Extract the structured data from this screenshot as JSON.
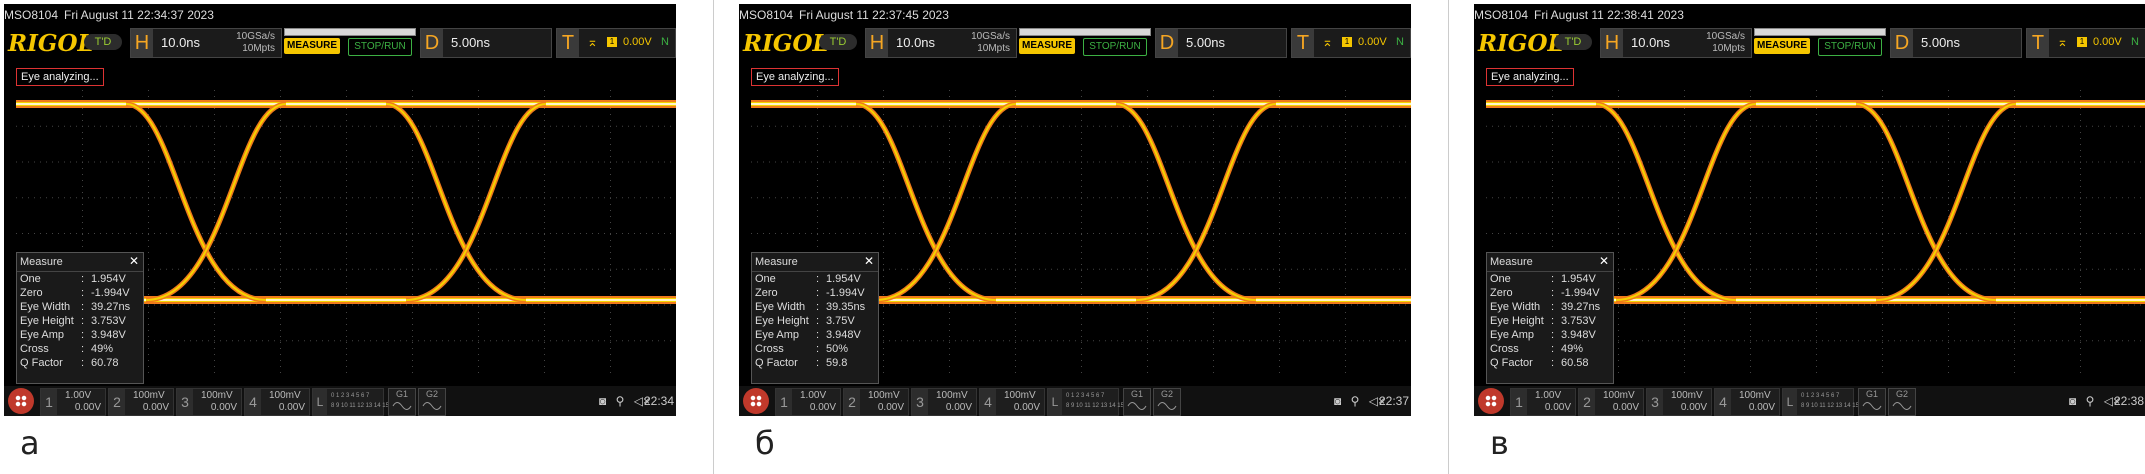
{
  "panels": [
    {
      "caption": "а",
      "model": "MSO8104",
      "datetime": "Fri August 11 22:34:37 2023",
      "logo": "RIGOL",
      "td": "T'D",
      "h_letter": "H",
      "timebase": "10.0ns",
      "samplerate": "10GSa/s",
      "memdepth": "10Mpts",
      "measure_btn": "MEASURE",
      "stop_btn": "STOP/RUN",
      "d_letter": "D",
      "delay": "5.00ns",
      "t_letter": "T",
      "trig_level": "0.00V",
      "trig_mode": "N",
      "trig_src": "1",
      "status": "Eye analyzing...",
      "measure": {
        "title": "Measure",
        "close": "✕",
        "rows": [
          {
            "k": "One",
            "v": "1.954V"
          },
          {
            "k": "Zero",
            "v": "-1.994V"
          },
          {
            "k": "Eye Width",
            "v": "39.27ns"
          },
          {
            "k": "Eye Height",
            "v": "3.753V"
          },
          {
            "k": "Eye Amp",
            "v": "3.948V"
          },
          {
            "k": "Cross",
            "v": "49%"
          },
          {
            "k": "Q Factor",
            "v": "60.78"
          }
        ]
      },
      "channels": [
        {
          "n": "1",
          "scale": "1.00V",
          "off": "0.00V"
        },
        {
          "n": "2",
          "scale": "100mV",
          "off": "0.00V"
        },
        {
          "n": "3",
          "scale": "100mV",
          "off": "0.00V"
        },
        {
          "n": "4",
          "scale": "100mV",
          "off": "0.00V"
        }
      ],
      "logic": {
        "n": "L",
        "r1": "0 1 2 3  4 5 6 7",
        "r2": "8 9 10 11 12 13 14 15"
      },
      "g1": "G1",
      "g2": "G2",
      "time": "22:34"
    },
    {
      "caption": "б",
      "model": "MSO8104",
      "datetime": "Fri August 11 22:37:45 2023",
      "logo": "RIGOL",
      "td": "T'D",
      "h_letter": "H",
      "timebase": "10.0ns",
      "samplerate": "10GSa/s",
      "memdepth": "10Mpts",
      "measure_btn": "MEASURE",
      "stop_btn": "STOP/RUN",
      "d_letter": "D",
      "delay": "5.00ns",
      "t_letter": "T",
      "trig_level": "0.00V",
      "trig_mode": "N",
      "trig_src": "1",
      "status": "Eye analyzing...",
      "measure": {
        "title": "Measure",
        "close": "✕",
        "rows": [
          {
            "k": "One",
            "v": "1.954V"
          },
          {
            "k": "Zero",
            "v": "-1.994V"
          },
          {
            "k": "Eye Width",
            "v": "39.35ns"
          },
          {
            "k": "Eye Height",
            "v": "3.75V"
          },
          {
            "k": "Eye Amp",
            "v": "3.948V"
          },
          {
            "k": "Cross",
            "v": "50%"
          },
          {
            "k": "Q Factor",
            "v": "59.8"
          }
        ]
      },
      "channels": [
        {
          "n": "1",
          "scale": "1.00V",
          "off": "0.00V"
        },
        {
          "n": "2",
          "scale": "100mV",
          "off": "0.00V"
        },
        {
          "n": "3",
          "scale": "100mV",
          "off": "0.00V"
        },
        {
          "n": "4",
          "scale": "100mV",
          "off": "0.00V"
        }
      ],
      "logic": {
        "n": "L",
        "r1": "0 1 2 3  4 5 6 7",
        "r2": "8 9 10 11 12 13 14 15"
      },
      "g1": "G1",
      "g2": "G2",
      "time": "22:37"
    },
    {
      "caption": "в",
      "model": "MSO8104",
      "datetime": "Fri August 11 22:38:41 2023",
      "logo": "RIGOL",
      "td": "T'D",
      "h_letter": "H",
      "timebase": "10.0ns",
      "samplerate": "10GSa/s",
      "memdepth": "10Mpts",
      "measure_btn": "MEASURE",
      "stop_btn": "STOP/RUN",
      "d_letter": "D",
      "delay": "5.00ns",
      "t_letter": "T",
      "trig_level": "0.00V",
      "trig_mode": "N",
      "trig_src": "1",
      "status": "Eye analyzing...",
      "measure": {
        "title": "Measure",
        "close": "✕",
        "rows": [
          {
            "k": "One",
            "v": "1.954V"
          },
          {
            "k": "Zero",
            "v": "-1.994V"
          },
          {
            "k": "Eye Width",
            "v": "39.27ns"
          },
          {
            "k": "Eye Height",
            "v": "3.753V"
          },
          {
            "k": "Eye Amp",
            "v": "3.948V"
          },
          {
            "k": "Cross",
            "v": "49%"
          },
          {
            "k": "Q Factor",
            "v": "60.58"
          }
        ]
      },
      "channels": [
        {
          "n": "1",
          "scale": "1.00V",
          "off": "0.00V"
        },
        {
          "n": "2",
          "scale": "100mV",
          "off": "0.00V"
        },
        {
          "n": "3",
          "scale": "100mV",
          "off": "0.00V"
        },
        {
          "n": "4",
          "scale": "100mV",
          "off": "0.00V"
        }
      ],
      "logic": {
        "n": "L",
        "r1": "0 1 2 3  4 5 6 7",
        "r2": "8 9 10 11 12 13 14 15"
      },
      "g1": "G1",
      "g2": "G2",
      "time": "22:38"
    }
  ],
  "colors": {
    "trace": "#f07a1a",
    "trace_hot": "#f5d400",
    "trace_core": "#fff6c8",
    "logo": "#f5c600"
  },
  "icons": [
    "camera-icon",
    "usb-icon",
    "speaker-icon"
  ]
}
